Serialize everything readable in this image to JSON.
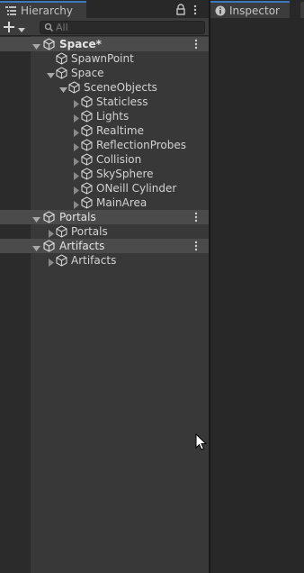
{
  "hierarchy": {
    "tab_label": "Hierarchy",
    "search": {
      "placeholder": "All"
    },
    "rows": [
      {
        "label": "Space*",
        "type": "scene",
        "depth": 0,
        "expanded": true
      },
      {
        "label": "SpawnPoint",
        "type": "object",
        "depth": 1,
        "expanded": null
      },
      {
        "label": "Space",
        "type": "object",
        "depth": 1,
        "expanded": true
      },
      {
        "label": "SceneObjects",
        "type": "object",
        "depth": 2,
        "expanded": true
      },
      {
        "label": "Staticless",
        "type": "object",
        "depth": 3,
        "expanded": false
      },
      {
        "label": "Lights",
        "type": "object",
        "depth": 3,
        "expanded": false
      },
      {
        "label": "Realtime",
        "type": "object",
        "depth": 3,
        "expanded": false
      },
      {
        "label": "ReflectionProbes",
        "type": "object",
        "depth": 3,
        "expanded": false
      },
      {
        "label": "Collision",
        "type": "object",
        "depth": 3,
        "expanded": false
      },
      {
        "label": "SkySphere",
        "type": "object",
        "depth": 3,
        "expanded": false
      },
      {
        "label": "ONeill Cylinder",
        "type": "object",
        "depth": 3,
        "expanded": false
      },
      {
        "label": "MainArea",
        "type": "object",
        "depth": 3,
        "expanded": false
      },
      {
        "label": "Portals",
        "type": "scene",
        "depth": 0,
        "expanded": true
      },
      {
        "label": "Portals",
        "type": "object",
        "depth": 1,
        "expanded": false
      },
      {
        "label": "Artifacts",
        "type": "scene",
        "depth": 0,
        "expanded": true
      },
      {
        "label": "Artifacts",
        "type": "object",
        "depth": 1,
        "expanded": false
      }
    ]
  },
  "inspector": {
    "tab_label": "Inspector"
  },
  "colors": {
    "accent": "#3a79bb",
    "panel": "#383838",
    "scene_row": "#4b4b4b"
  }
}
